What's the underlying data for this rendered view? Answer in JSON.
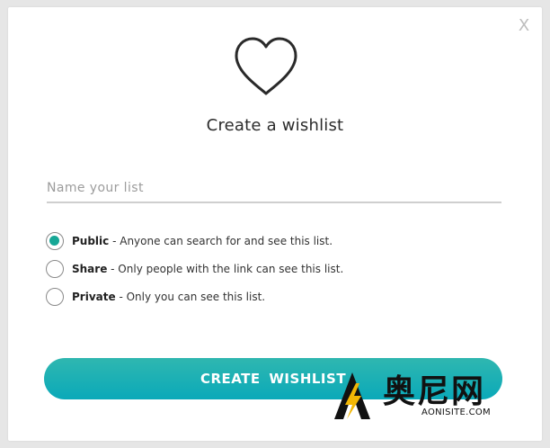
{
  "dialog": {
    "close_label": "X",
    "title": "Create a wishlist",
    "name_input": {
      "placeholder": "Name your list",
      "value": ""
    },
    "visibility_options": [
      {
        "label": "Public",
        "description": " - Anyone can search for and see this list.",
        "selected": true
      },
      {
        "label": "Share",
        "description": " - Only people with the link can see this list.",
        "selected": false
      },
      {
        "label": "Private",
        "description": " - Only you can see this list.",
        "selected": false
      }
    ],
    "create_button_label": "CREATE  WISHLIST"
  },
  "icons": {
    "close": "close-icon",
    "heart": "heart-icon",
    "radio": "radio-icon"
  },
  "colors": {
    "accent": "#16a796",
    "button_gradient_start": "#2fb7b0",
    "button_gradient_end": "#0aa9b9"
  },
  "watermark": {
    "cn_text": "奥尼网",
    "en_text": "AONISITE.COM"
  }
}
